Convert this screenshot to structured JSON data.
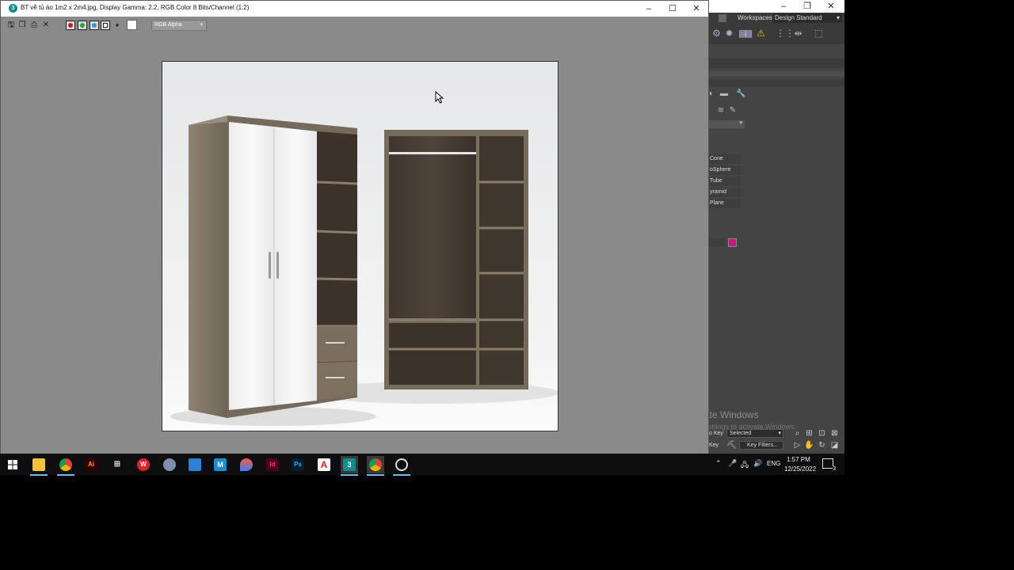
{
  "frame_buffer": {
    "title": "BT vẽ tủ áo 1m2 x 2m4.jpg, Display Gamma: 2.2, RGB Color 8 Bits/Channel (1:2)",
    "channel_select": "RGB Alpha",
    "channels": [
      {
        "name": "red",
        "color": "#c81c1c"
      },
      {
        "name": "green",
        "color": "#2c9e3a"
      },
      {
        "name": "blue",
        "color": "#2a9bd8"
      },
      {
        "name": "mono",
        "color": "#555555"
      }
    ]
  },
  "max_app": {
    "workspaces_label": "Workspaces:",
    "workspace_value": "Design Standard",
    "object_types": [
      "Cone",
      "oSphere",
      "Tube",
      "yramid",
      "Plane"
    ],
    "object_color": "#d0157a",
    "key_selected": "Selected",
    "key_filters": "Key Filters...",
    "key_label_1": "o Key",
    "key_label_2": "Key"
  },
  "watermark": {
    "title": "Activate Windows",
    "subtitle": "Go to Settings to activate Windows."
  },
  "taskbar": {
    "apps": [
      "start",
      "file-explorer",
      "chrome",
      "illustrator",
      "app-grid",
      "wps",
      "network-app",
      "store",
      "m-app",
      "color-app",
      "indesign",
      "photoshop",
      "acrobat",
      "3ds-max",
      "chrome-badge",
      "speed-app"
    ],
    "tray_lang": "ENG",
    "time": "1:57 PM",
    "date": "12/25/2022",
    "notification_count": "3"
  },
  "colors": {
    "max_dark": "#444444",
    "frame_gray": "#8a8a8a",
    "taskbar": "#0e0e10",
    "accent": "#76b9ed"
  }
}
